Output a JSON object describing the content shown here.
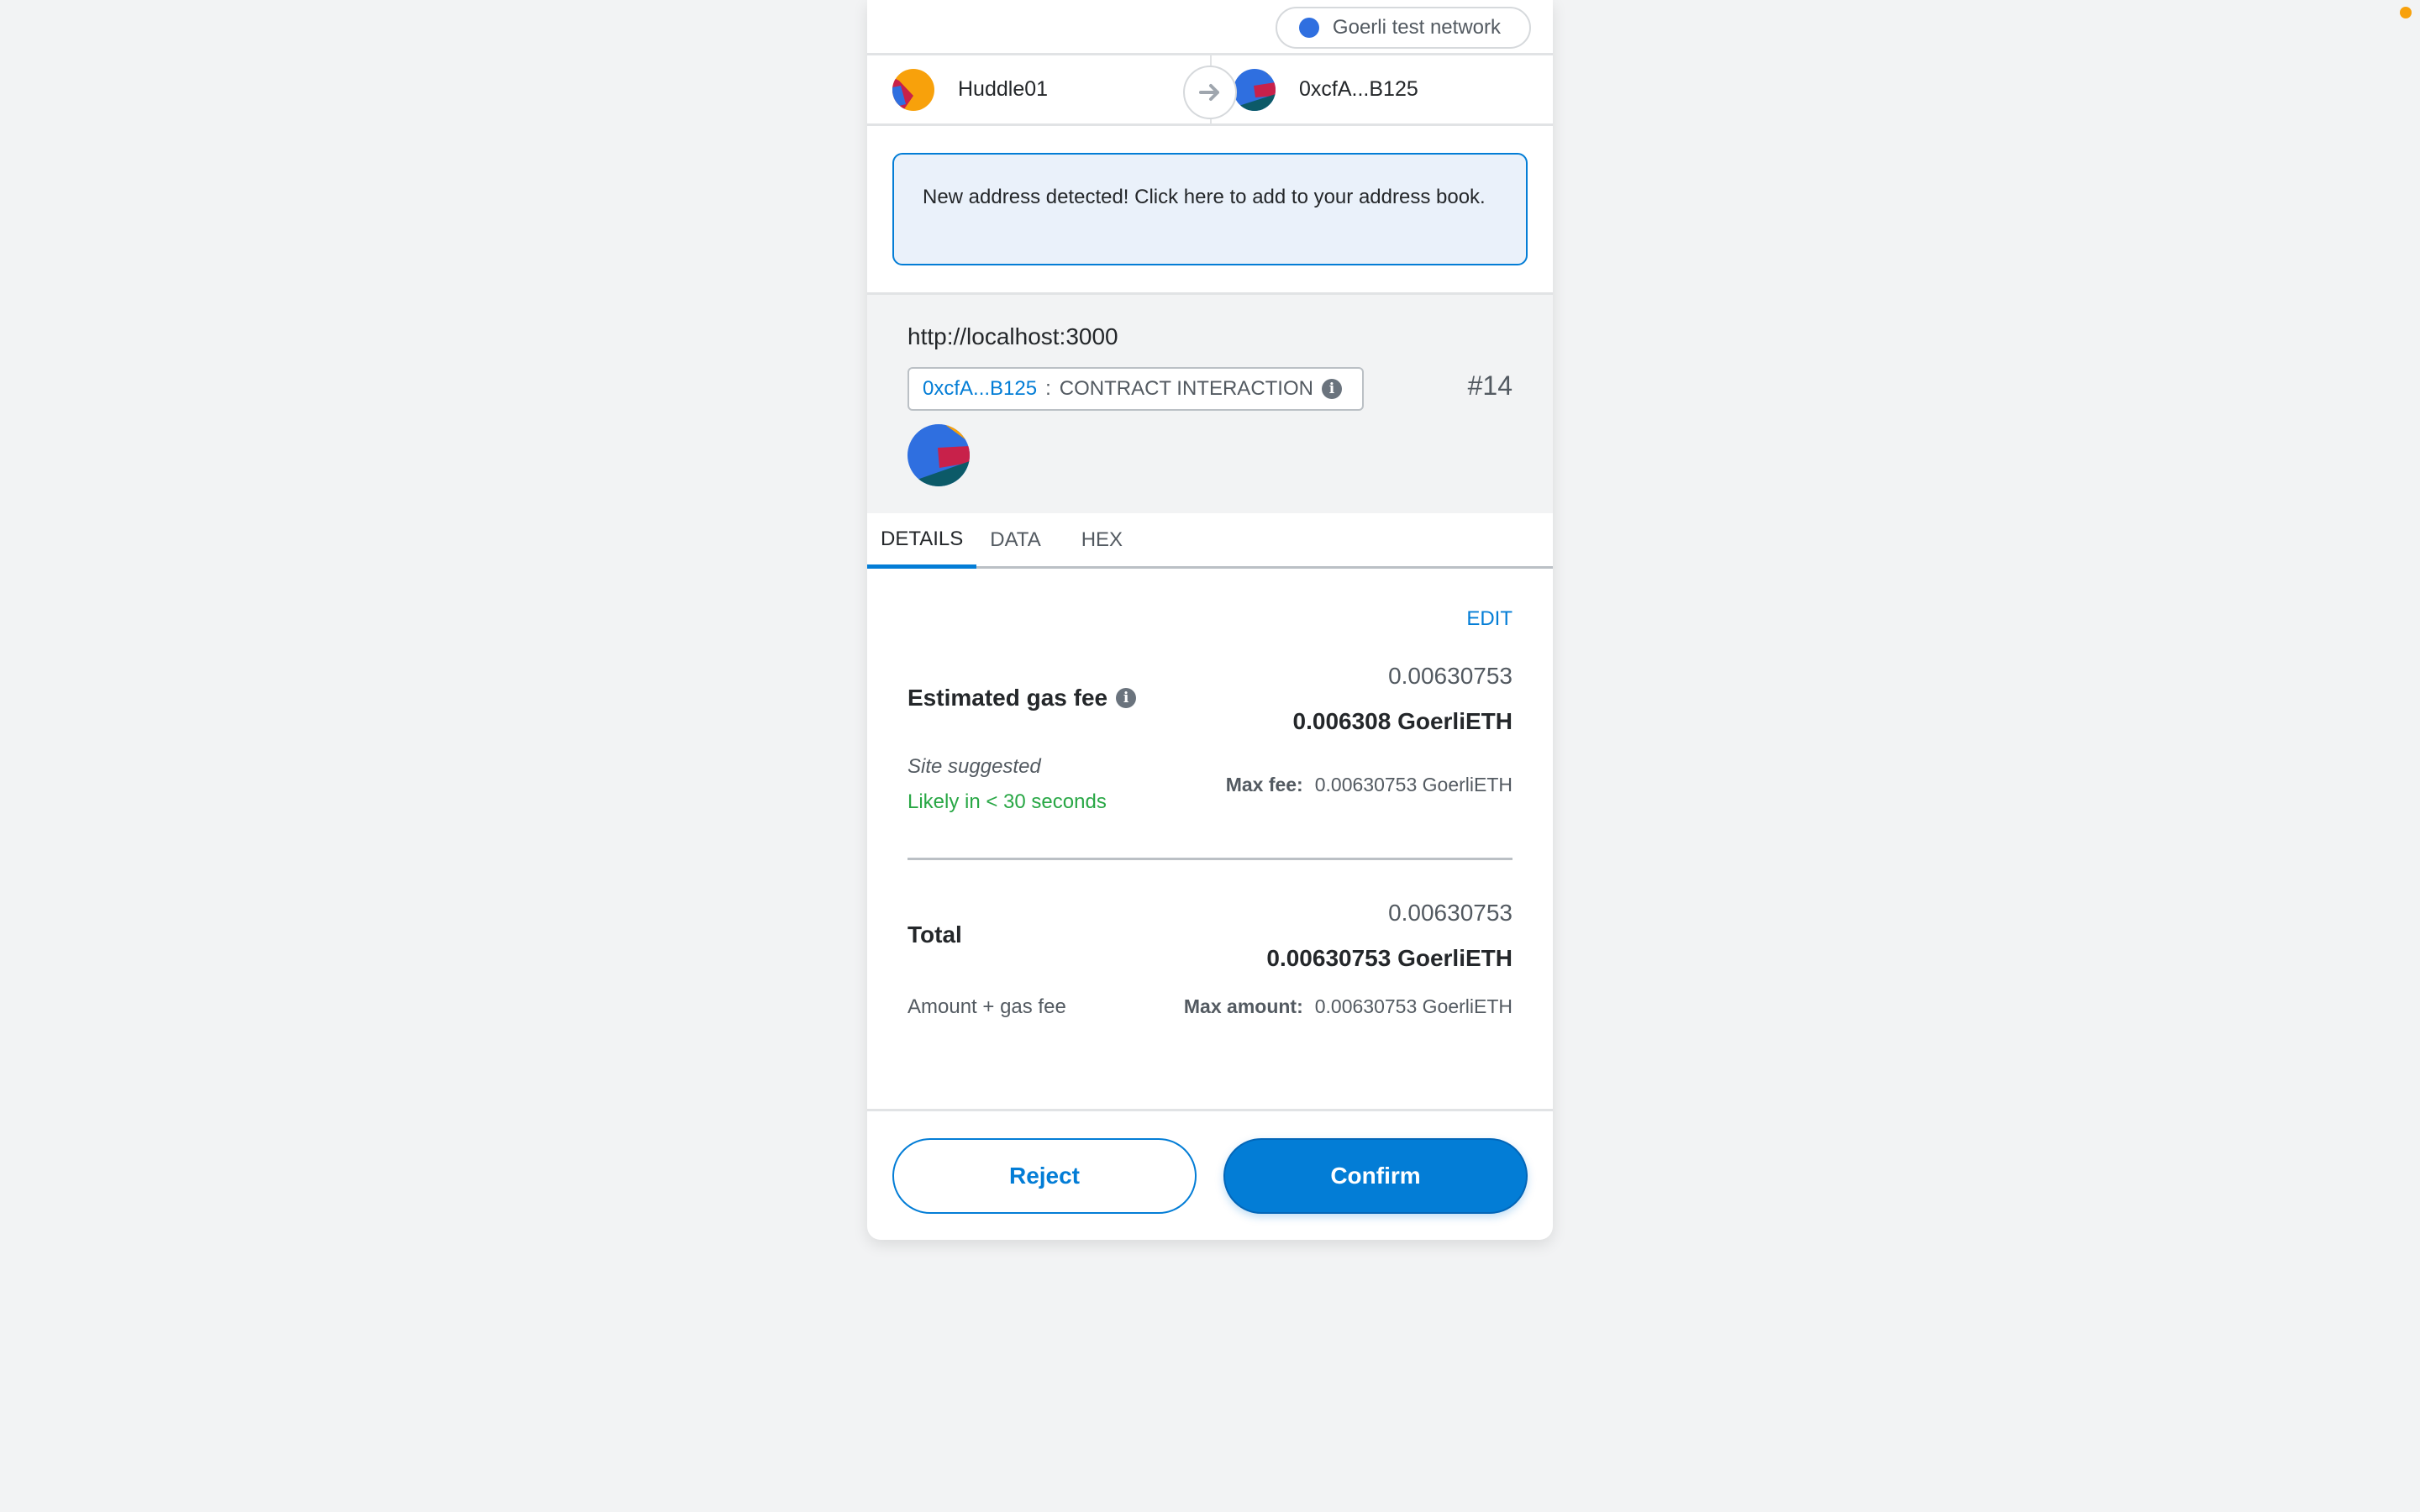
{
  "network": {
    "label": "Goerli test network",
    "dot_color": "#2f6fe0"
  },
  "accounts": {
    "from": {
      "name": "Huddle01",
      "icon": "jazzicon-avatar"
    },
    "arrow_icon": "arrow-right-icon",
    "to": {
      "name": "0xcfA...B125",
      "icon": "jazzicon-avatar"
    }
  },
  "banner": {
    "text": "New address detected! Click here to add to your address book."
  },
  "origin": {
    "url": "http://localhost:3000",
    "contract_address": "0xcfA...B125",
    "separator": ":",
    "method": "CONTRACT INTERACTION",
    "info_icon": "i",
    "nonce": "#14"
  },
  "tabs": [
    {
      "label": "DETAILS",
      "active": true
    },
    {
      "label": "DATA",
      "active": false
    },
    {
      "label": "HEX",
      "active": false
    }
  ],
  "details": {
    "edit_label": "EDIT",
    "gas": {
      "label": "Estimated gas fee",
      "info_icon": "i",
      "secondary_amount": "0.00630753",
      "primary_amount": "0.006308 GoerliETH",
      "source": "Site suggested",
      "timing": "Likely in < 30 seconds",
      "max_label": "Max fee:",
      "max_value": "0.00630753 GoerliETH"
    },
    "total": {
      "label": "Total",
      "secondary_amount": "0.00630753",
      "primary_amount": "0.00630753 GoerliETH",
      "sub_label": "Amount + gas fee",
      "max_label": "Max amount:",
      "max_value": "0.00630753 GoerliETH"
    }
  },
  "footer": {
    "reject_label": "Reject",
    "confirm_label": "Confirm"
  },
  "colors": {
    "primary": "#037dd6",
    "success": "#28a745",
    "status_dot": "#f8a10b"
  }
}
